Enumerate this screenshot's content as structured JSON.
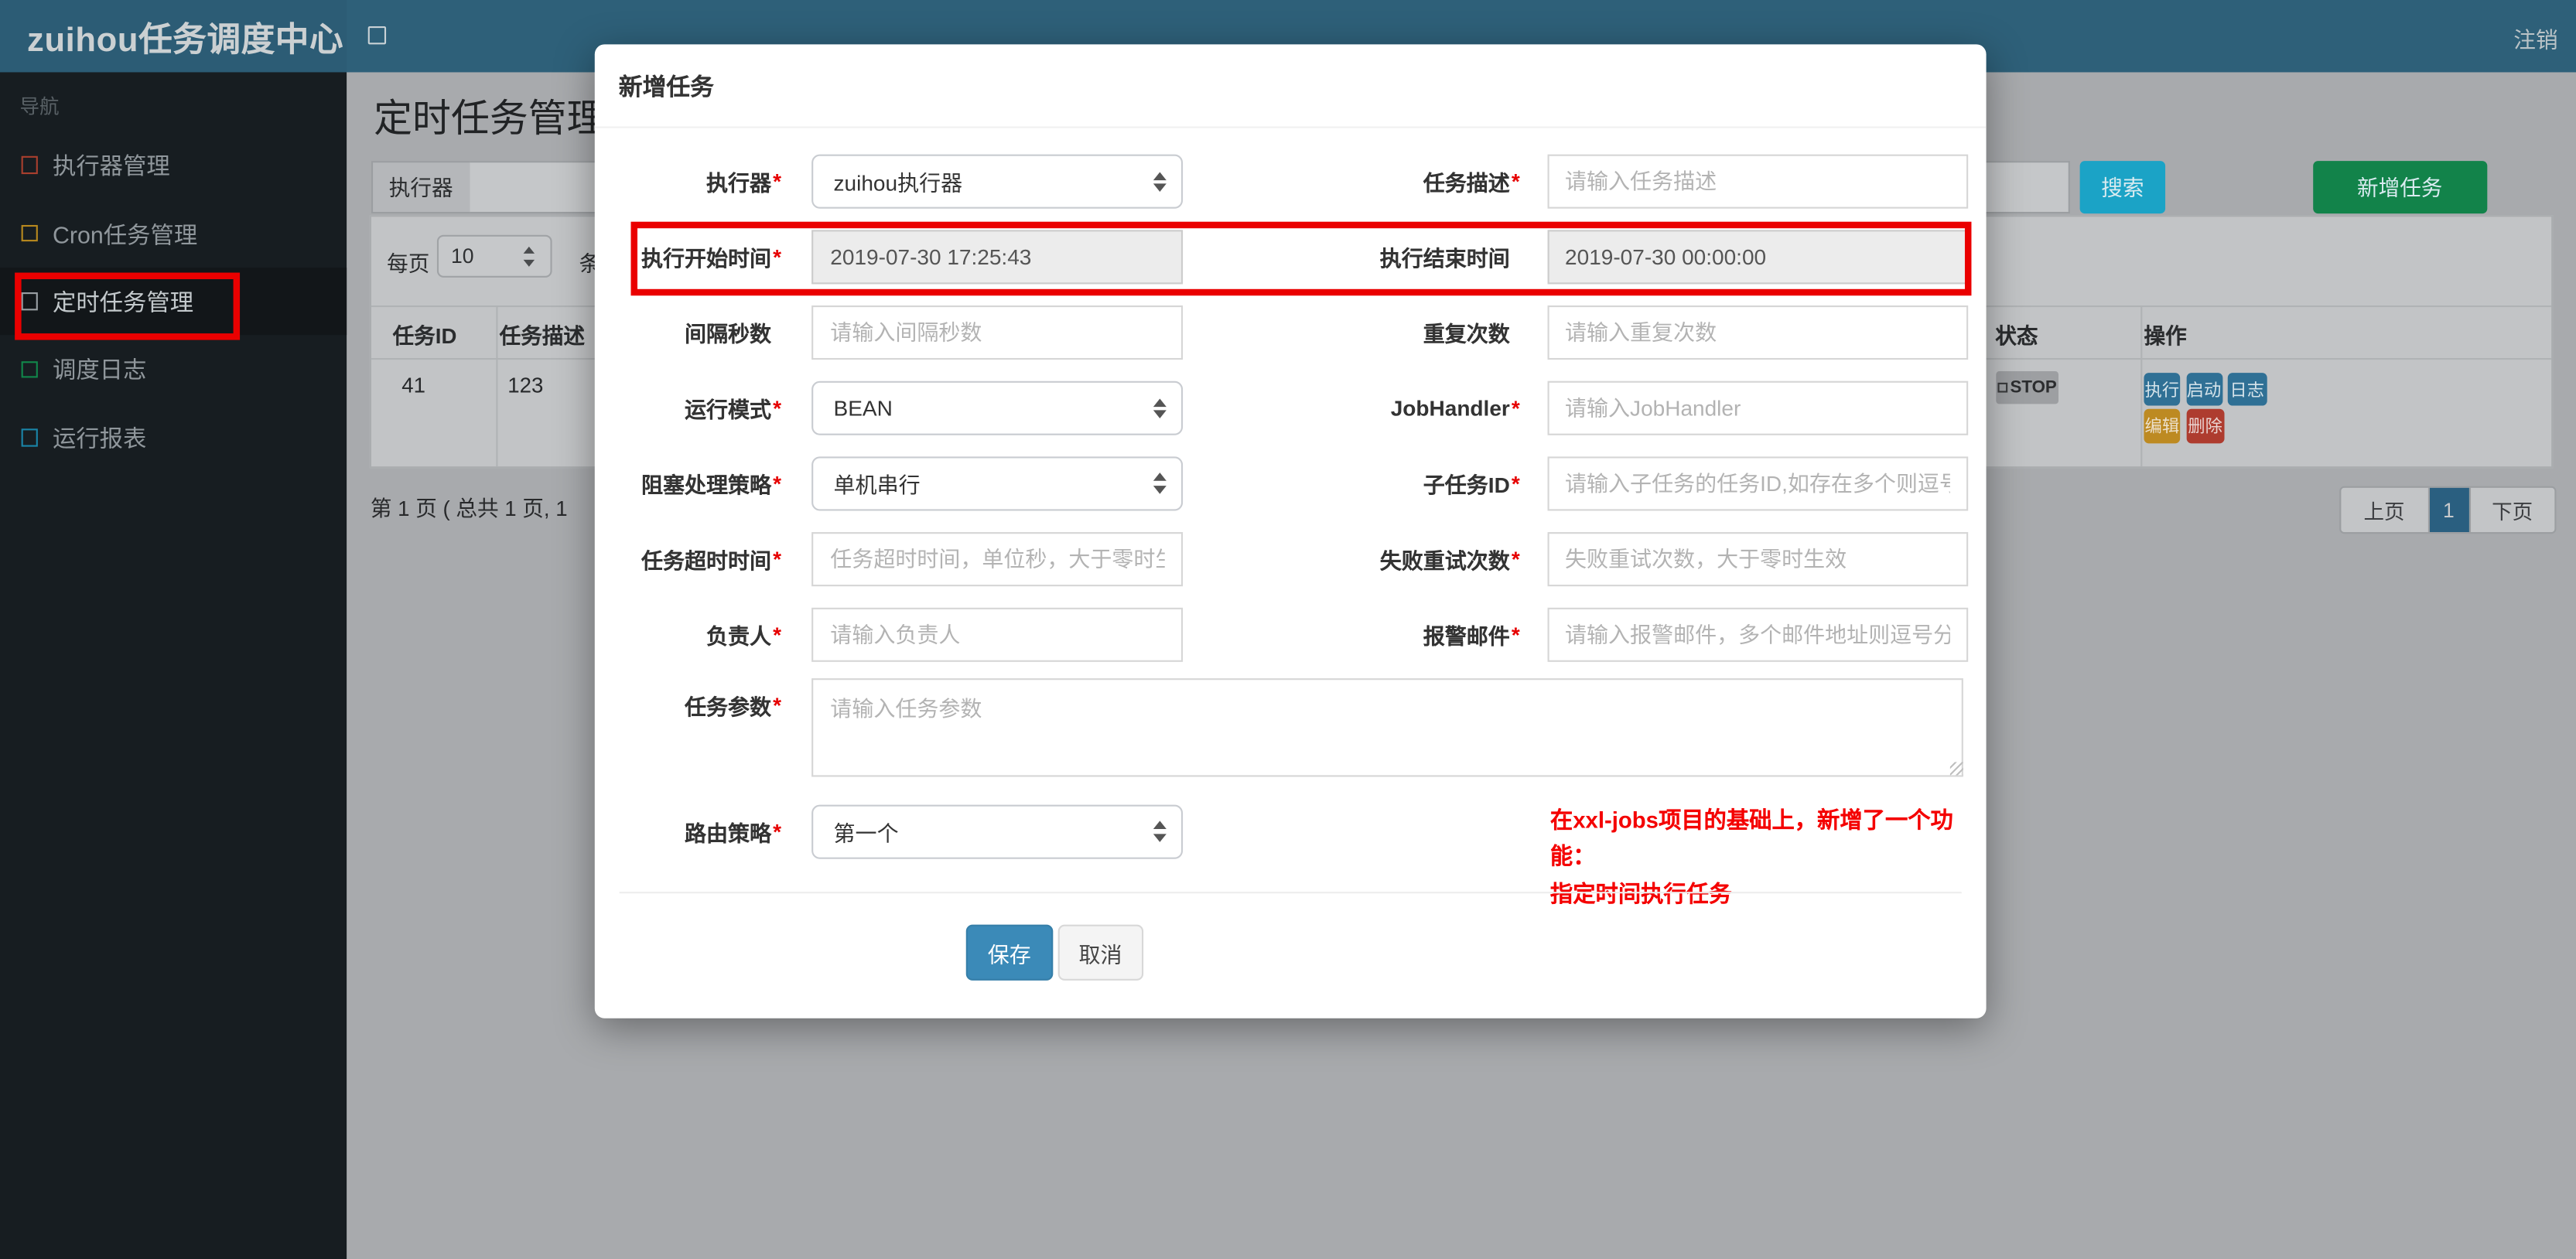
{
  "colors": {
    "navbar_bg": "#2e6079",
    "logo_bg": "#2c5c75",
    "sidebar_bg": "#171d21",
    "primary_blue": "#3b8ab8",
    "info_cyan": "#1ba3c6",
    "success_green": "#12834a",
    "warning_orange": "#bd8a22",
    "danger_red": "#ae3c2f",
    "annotation_red": "#ea0000",
    "pager_active": "#2a5f80"
  },
  "navbar": {
    "brand": "zuihou任务调度中心",
    "logout": "注销"
  },
  "sidebar": {
    "header": "导航",
    "items": [
      {
        "label": "执行器管理",
        "icon_color": "#a93f2e"
      },
      {
        "label": "Cron任务管理",
        "icon_color": "#b8891e"
      },
      {
        "label": "定时任务管理",
        "icon_color": "#9aa0a4"
      },
      {
        "label": "调度日志",
        "icon_color": "#11874b"
      },
      {
        "label": "运行报表",
        "icon_color": "#1a85a8"
      }
    ]
  },
  "page": {
    "title": "定时任务管理",
    "filter": {
      "executor_label": "执行器"
    },
    "search_btn": "搜索",
    "add_btn": "新增任务",
    "per_page": {
      "prefix": "每页",
      "value": "10",
      "suffix": "条记"
    },
    "table": {
      "headers": [
        "任务ID",
        "任务描述",
        "状态",
        "操作"
      ],
      "row": {
        "id": "41",
        "desc": "123",
        "status": "STOP",
        "ops": [
          "执行",
          "启动",
          "日志",
          "编辑",
          "删除"
        ]
      }
    },
    "pagination": {
      "summary": "第 1 页 ( 总共 1 页, 1",
      "prev": "上页",
      "current": "1",
      "next": "下页"
    }
  },
  "modal": {
    "title": "新增任务",
    "asterisk": "*",
    "fields": {
      "executor": {
        "label": "执行器",
        "required": true,
        "value": "zuihou执行器"
      },
      "job_desc": {
        "label": "任务描述",
        "required": true,
        "placeholder": "请输入任务描述"
      },
      "start_time": {
        "label": "执行开始时间",
        "required": true,
        "value": "2019-07-30 17:25:43"
      },
      "end_time": {
        "label": "执行结束时间",
        "required": false,
        "value": "2019-07-30 00:00:00"
      },
      "interval": {
        "label": "间隔秒数",
        "required": false,
        "placeholder": "请输入间隔秒数"
      },
      "repeat_count": {
        "label": "重复次数",
        "required": false,
        "placeholder": "请输入重复次数"
      },
      "glue_type": {
        "label": "运行模式",
        "required": true,
        "value": "BEAN"
      },
      "job_handler": {
        "label": "JobHandler",
        "required": true,
        "placeholder": "请输入JobHandler"
      },
      "block_strategy": {
        "label": "阻塞处理策略",
        "required": true,
        "value": "单机串行"
      },
      "child_jobid": {
        "label": "子任务ID",
        "required": true,
        "placeholder": "请输入子任务的任务ID,如存在多个则逗号分隔"
      },
      "timeout": {
        "label": "任务超时时间",
        "required": true,
        "placeholder": "任务超时时间，单位秒，大于零时生效"
      },
      "fail_retry": {
        "label": "失败重试次数",
        "required": true,
        "placeholder": "失败重试次数，大于零时生效"
      },
      "author": {
        "label": "负责人",
        "required": true,
        "placeholder": "请输入负责人"
      },
      "alarm_email": {
        "label": "报警邮件",
        "required": true,
        "placeholder": "请输入报警邮件，多个邮件地址则逗号分隔"
      },
      "job_param": {
        "label": "任务参数",
        "required": true,
        "placeholder": "请输入任务参数"
      },
      "route_strategy": {
        "label": "路由策略",
        "required": true,
        "value": "第一个"
      }
    },
    "note_line1": "在xxl-jobs项目的基础上，新增了一个功能：",
    "note_line2": "指定时间执行任务",
    "save_btn": "保存",
    "cancel_btn": "取消"
  }
}
